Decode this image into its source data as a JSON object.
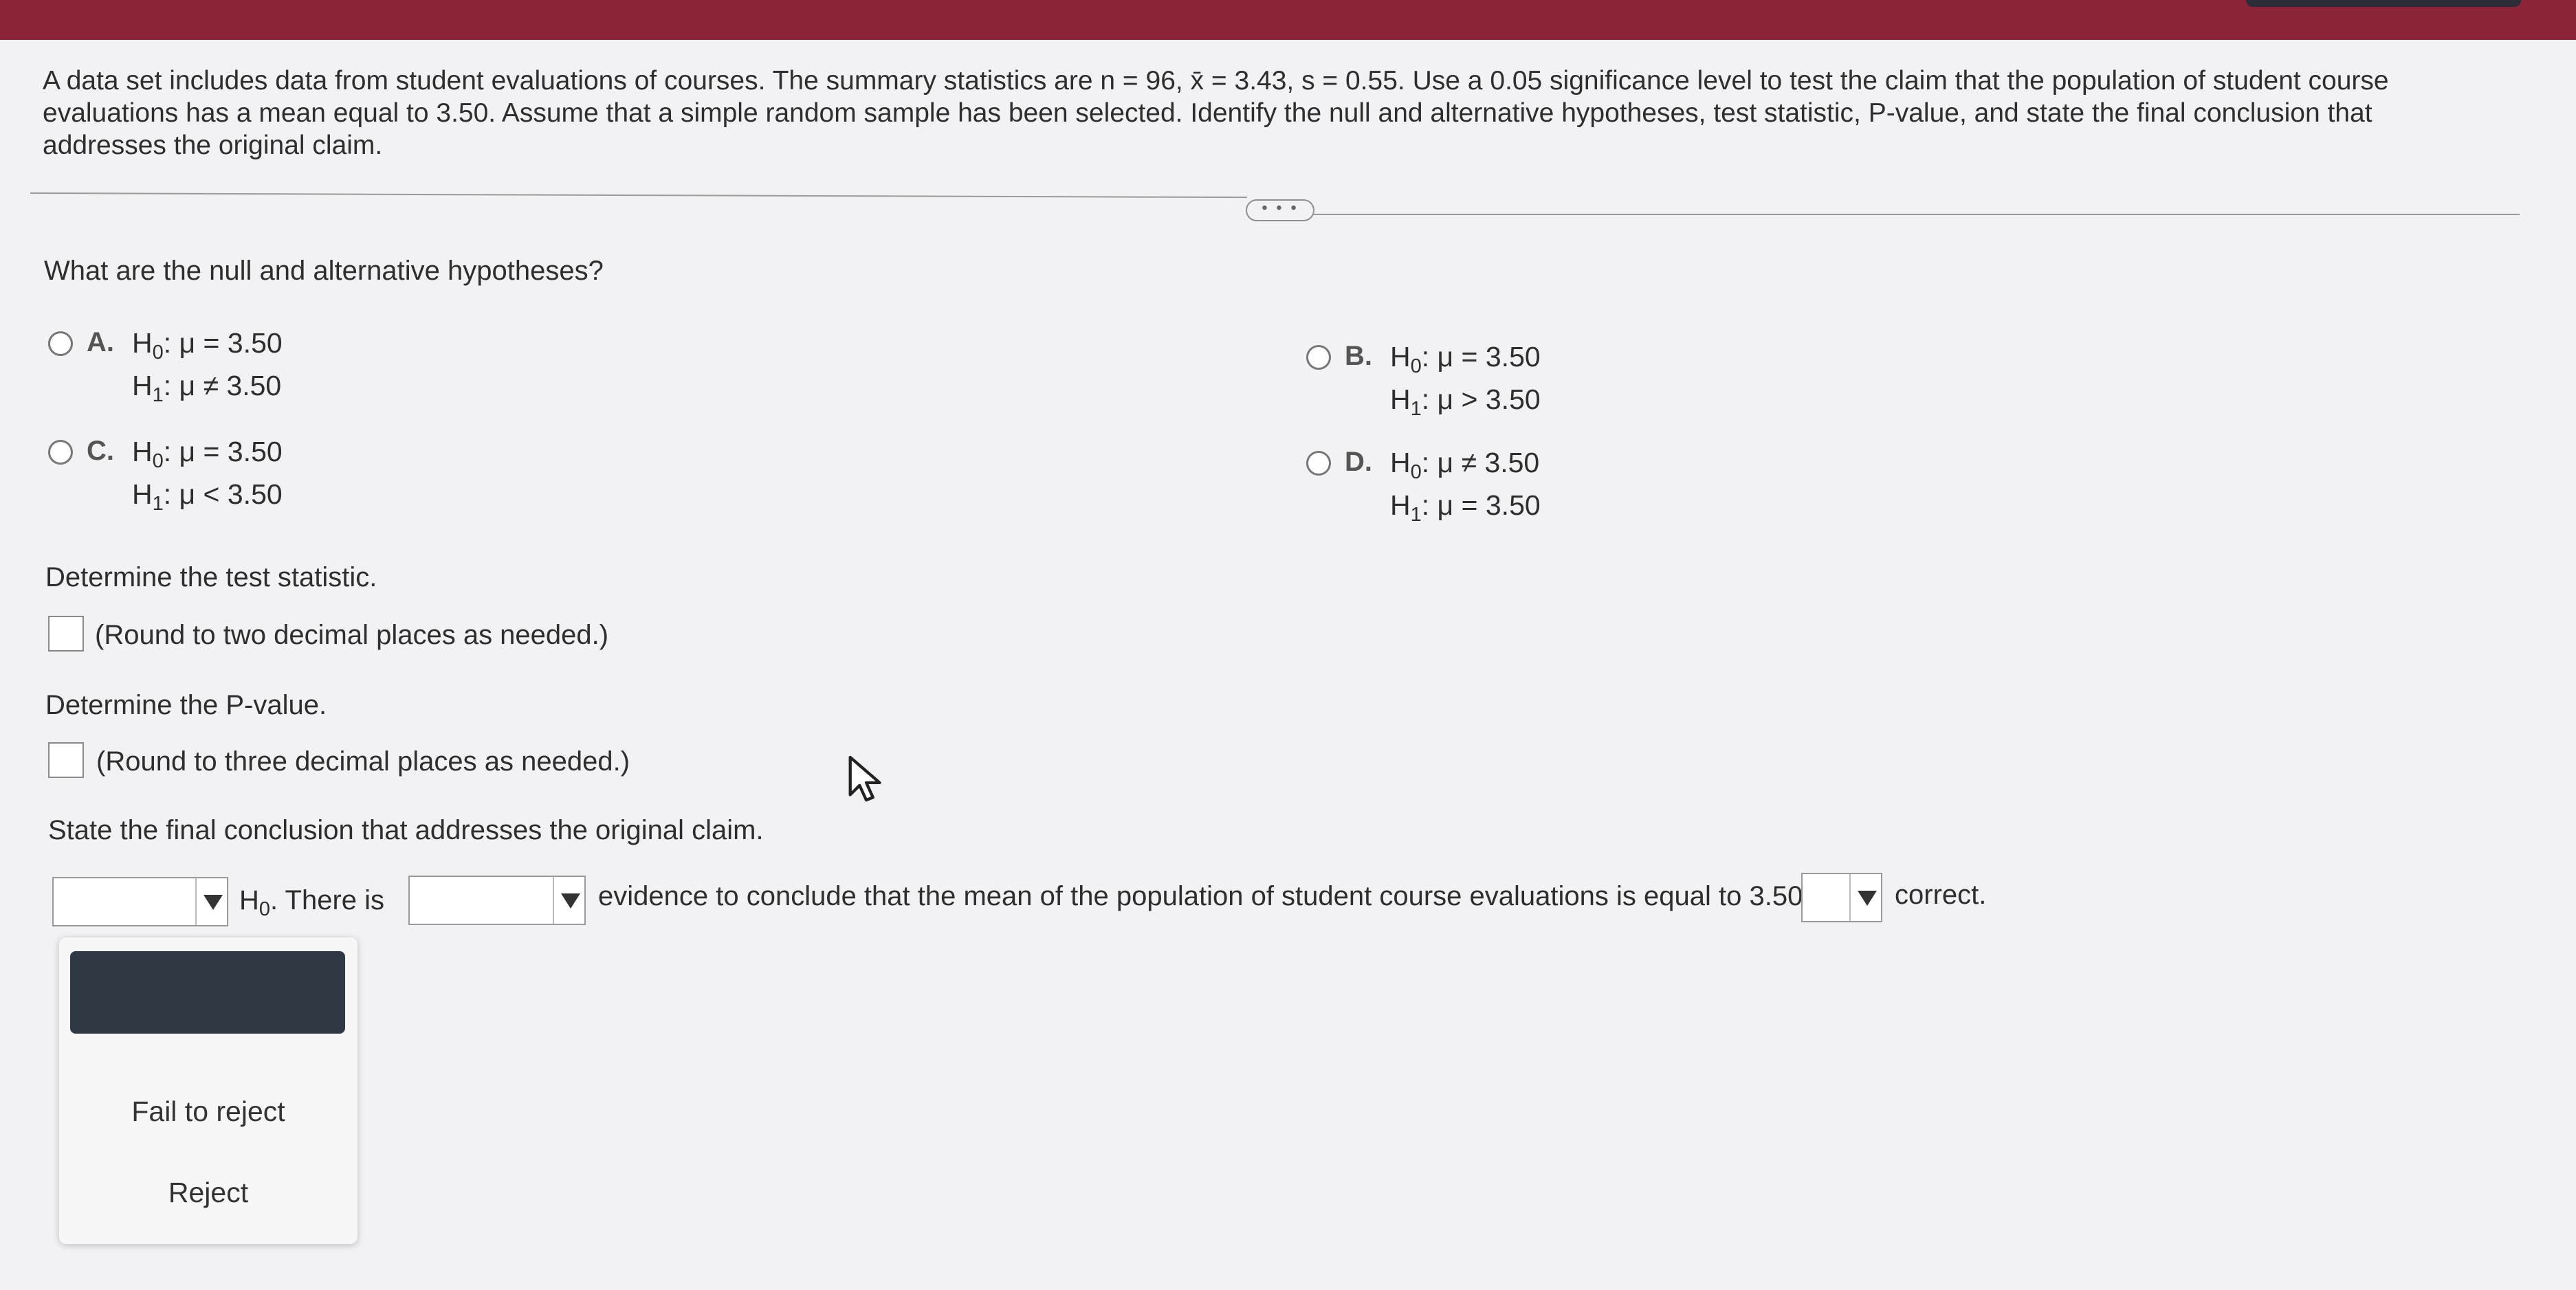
{
  "problem": {
    "text": "A data set includes data from student evaluations of courses. The summary statistics are n = 96, x̄ = 3.43, s = 0.55. Use a 0.05 significance level to test the claim that the population of student course evaluations has a mean equal to 3.50. Assume that a simple random sample has been selected. Identify the null and alternative hypotheses, test statistic, P-value, and state the final conclusion that addresses the original claim."
  },
  "more_button": "• • •",
  "hypotheses": {
    "question": "What are the null and alternative hypotheses?",
    "options": [
      {
        "letter": "A.",
        "h0_rel": ": μ = 3.50",
        "h1_rel": ": μ ≠ 3.50"
      },
      {
        "letter": "B.",
        "h0_rel": ": μ = 3.50",
        "h1_rel": ": μ > 3.50"
      },
      {
        "letter": "C.",
        "h0_rel": ": μ = 3.50",
        "h1_rel": ": μ < 3.50"
      },
      {
        "letter": "D.",
        "h0_rel": ": μ ≠ 3.50",
        "h1_rel": ": μ = 3.50"
      }
    ],
    "h0_letter": "H",
    "h0_sub": "0",
    "h1_letter": "H",
    "h1_sub": "1"
  },
  "test_statistic": {
    "prompt": "Determine the test statistic.",
    "hint": "(Round to two decimal places as needed.)",
    "value": ""
  },
  "p_value": {
    "prompt": "Determine the P-value.",
    "hint": "(Round to three decimal places as needed.)",
    "value": ""
  },
  "conclusion": {
    "prompt": "State the final conclusion that addresses the original claim.",
    "h0_letter": "H",
    "h0_sub": "0",
    "text_after_h0": ". There is",
    "text_middle": "evidence to conclude that the mean of the population of student course evaluations is equal to 3.50",
    "text_end": "correct.",
    "dropdown1": {
      "selected": "",
      "options": [
        "Fail to reject",
        "Reject"
      ]
    },
    "dropdown2": {
      "selected": ""
    },
    "dropdown3": {
      "selected": ""
    }
  },
  "colors": {
    "top_bar": "#8c2438",
    "menu_highlight": "#2f3944"
  },
  "icons": [
    "mouse-pointer-icon",
    "dropdown-arrow-icon",
    "radio-button-icon"
  ]
}
